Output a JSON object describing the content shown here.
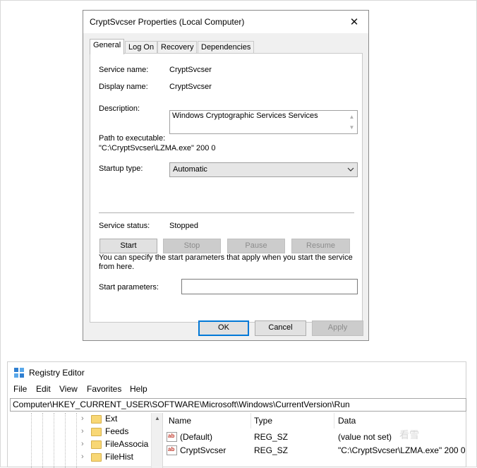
{
  "dialog": {
    "title": "CryptSvcser Properties (Local Computer)",
    "tabs": [
      "General",
      "Log On",
      "Recovery",
      "Dependencies"
    ],
    "service_name_label": "Service name:",
    "service_name": "CryptSvcser",
    "display_name_label": "Display name:",
    "display_name": "CryptSvcser",
    "description_label": "Description:",
    "description": "Windows Cryptographic Services Services",
    "path_label": "Path to executable:",
    "path": "\"C:\\CryptSvcser\\LZMA.exe\" 200 0",
    "startup_type_label": "Startup type:",
    "startup_type": "Automatic",
    "status_label": "Service status:",
    "status": "Stopped",
    "buttons": {
      "start": "Start",
      "stop": "Stop",
      "pause": "Pause",
      "resume": "Resume"
    },
    "info": "You can specify the start parameters that apply when you start the service from here.",
    "start_params_label": "Start parameters:",
    "start_params_value": "",
    "ok": "OK",
    "cancel": "Cancel",
    "apply": "Apply"
  },
  "registry": {
    "title": "Registry Editor",
    "menu": [
      "File",
      "Edit",
      "View",
      "Favorites",
      "Help"
    ],
    "address": "Computer\\HKEY_CURRENT_USER\\SOFTWARE\\Microsoft\\Windows\\CurrentVersion\\Run",
    "tree": [
      "Ext",
      "Feeds",
      "FileAssocia",
      "FileHist"
    ],
    "columns": [
      "Name",
      "Type",
      "Data"
    ],
    "rows": [
      {
        "name": "(Default)",
        "type": "REG_SZ",
        "data": "(value not set)"
      },
      {
        "name": "CryptSvcser",
        "type": "REG_SZ",
        "data": "\"C:\\CryptSvcser\\LZMA.exe\" 200 0"
      }
    ]
  },
  "watermark": "看雪"
}
